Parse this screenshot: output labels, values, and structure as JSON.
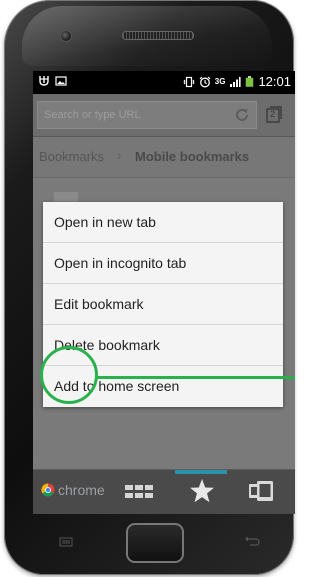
{
  "status_bar": {
    "network": "3G",
    "time": "12:01"
  },
  "omnibox": {
    "placeholder": "Search or type URL",
    "tab_count": "2"
  },
  "breadcrumb": {
    "root": "Bookmarks",
    "separator": "›",
    "current": "Mobile bookmarks"
  },
  "context_menu": {
    "items": [
      {
        "label": "Open in new tab"
      },
      {
        "label": "Open in incognito tab"
      },
      {
        "label": "Edit bookmark"
      },
      {
        "label": "Delete bookmark"
      },
      {
        "label": "Add to home screen"
      }
    ]
  },
  "bottom_bar": {
    "chrome_label": "chrome"
  },
  "colors": {
    "highlight": "#29b24b",
    "accent": "#2f8fb0"
  },
  "icons": {
    "status_left": [
      "usb-debug-icon",
      "image-notification-icon"
    ],
    "status_right": [
      "vibrate-icon",
      "alarm-icon",
      "signal-icon",
      "battery-icon"
    ],
    "toolbar": [
      "reload-icon",
      "tab-switcher-icon"
    ],
    "bottom": [
      "chrome-logo-icon",
      "most-visited-grid-icon",
      "bookmarks-star-icon",
      "other-devices-icon"
    ]
  }
}
